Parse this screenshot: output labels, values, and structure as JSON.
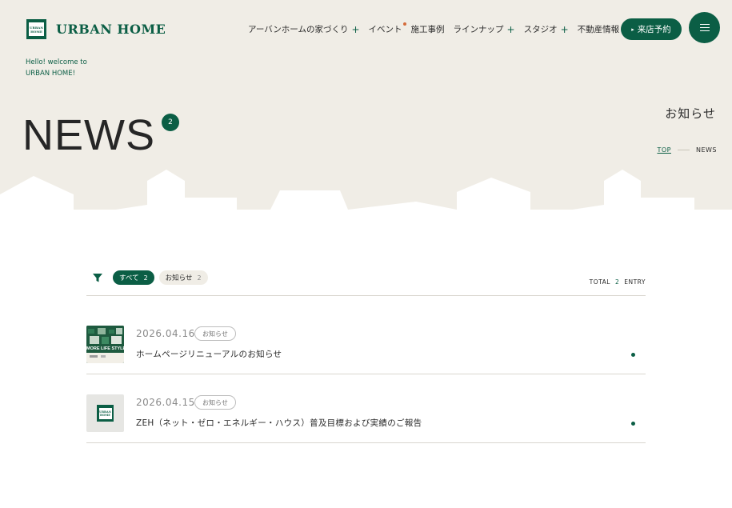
{
  "brand": {
    "logo_mark_line1": "URBAN",
    "logo_mark_line2": "HOME",
    "name": "URBAN HOME"
  },
  "nav": {
    "items": [
      {
        "label": "アーバンホームの家づくり",
        "has_plus": true
      },
      {
        "label": "イベント",
        "has_dot": true
      },
      {
        "label": "施工事例"
      },
      {
        "label": "ラインナップ",
        "has_plus": true
      },
      {
        "label": "スタジオ",
        "has_plus": true
      },
      {
        "label": "不動産情報",
        "has_plus": true
      }
    ],
    "plus_symbol": "+",
    "cta_label": "来店予約",
    "cta_icon": "▸",
    "menu_icon": "hamburger-icon"
  },
  "welcome": {
    "line1": "Hello! welcome to",
    "line2": "URBAN HOME!"
  },
  "hero": {
    "title": "NEWS",
    "badge_count": "2",
    "jp_title": "お知らせ",
    "breadcrumb_home": "TOP",
    "breadcrumb_current": "NEWS"
  },
  "filters": {
    "icon": "filter-icon",
    "chips": [
      {
        "label": "すべて",
        "count": "2",
        "active": true
      },
      {
        "label": "お知らせ",
        "count": "2",
        "active": false
      }
    ],
    "total_label": "TOTAL",
    "total_count": "2",
    "entry_label": "ENTRY"
  },
  "news": [
    {
      "date": "2026.04.16",
      "tag": "お知らせ",
      "title": "ホームページリニューアルのお知らせ",
      "thumb_text": "MORE LIFE STYLE"
    },
    {
      "date": "2026.04.15",
      "tag": "お知らせ",
      "title": "ZEH（ネット・ゼロ・エネルギー・ハウス）普及目標および実績のご報告",
      "thumb_logo_line1": "URBAN",
      "thumb_logo_line2": "HOME"
    }
  ],
  "colors": {
    "brand_green": "#0b5e45",
    "hero_beige": "#f0ede6",
    "accent_orange": "#d46b3a"
  }
}
